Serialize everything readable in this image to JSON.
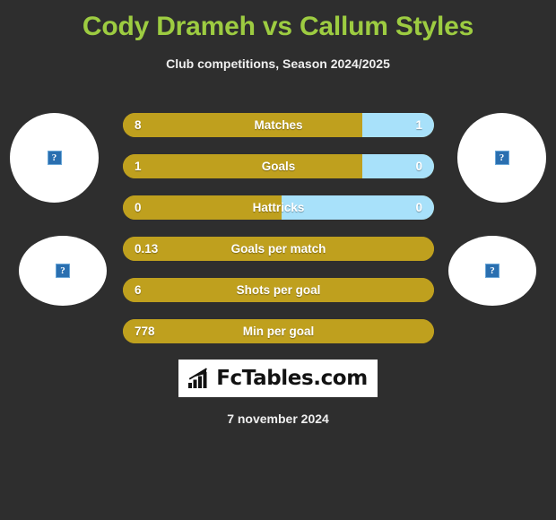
{
  "header": {
    "title": "Cody Drameh vs Callum Styles",
    "subtitle": "Club competitions, Season 2024/2025"
  },
  "colors": {
    "background": "#2e2e2e",
    "title_green": "#9dcc41",
    "home_gold": "#bfa01e",
    "away_blue": "#a8e1fa",
    "text_white": "#ffffff"
  },
  "avatars": [
    {
      "position": "left-top",
      "icon": "broken-image-icon",
      "glyph": "?"
    },
    {
      "position": "right-top",
      "icon": "broken-image-icon",
      "glyph": "?"
    },
    {
      "position": "left-bottom",
      "icon": "broken-image-icon",
      "glyph": "?"
    },
    {
      "position": "right-bottom",
      "icon": "broken-image-icon",
      "glyph": "?"
    }
  ],
  "stats": [
    {
      "label": "Matches",
      "home": "8",
      "away": "1",
      "home_pct": 77,
      "away_pct": 23,
      "split": true
    },
    {
      "label": "Goals",
      "home": "1",
      "away": "0",
      "home_pct": 77,
      "away_pct": 23,
      "split": true
    },
    {
      "label": "Hattricks",
      "home": "0",
      "away": "0",
      "home_pct": 51,
      "away_pct": 49,
      "split": true
    },
    {
      "label": "Goals per match",
      "home": "0.13",
      "away": "",
      "home_pct": 100,
      "away_pct": 0,
      "split": false
    },
    {
      "label": "Shots per goal",
      "home": "6",
      "away": "",
      "home_pct": 100,
      "away_pct": 0,
      "split": false
    },
    {
      "label": "Min per goal",
      "home": "778",
      "away": "",
      "home_pct": 100,
      "away_pct": 0,
      "split": false
    }
  ],
  "logo": {
    "text": "FcTables.com",
    "icon": "bar-chart-arrow-icon"
  },
  "footer": {
    "date": "7 november 2024"
  }
}
